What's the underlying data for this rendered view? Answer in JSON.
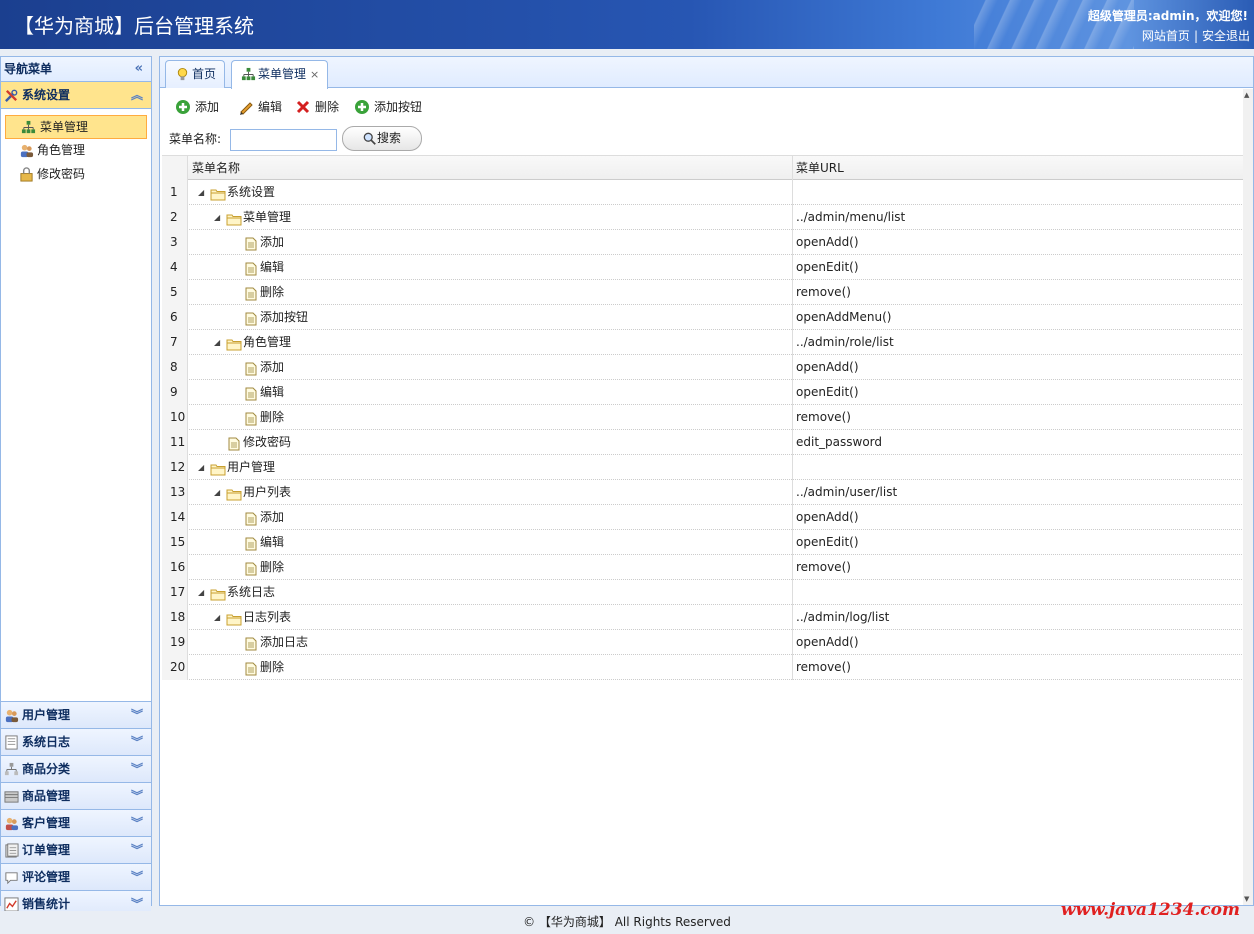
{
  "header": {
    "title": "【华为商城】后台管理系统",
    "user_text": "超级管理员:admin，欢迎您!",
    "link_home": "网站首页",
    "link_sep": "|",
    "link_logout": "安全退出"
  },
  "sidebar": {
    "title": "导航菜单",
    "active_section": {
      "label": "系统设置",
      "items": [
        "菜单管理",
        "角色管理",
        "修改密码"
      ]
    },
    "sections": [
      "用户管理",
      "系统日志",
      "商品分类",
      "商品管理",
      "客户管理",
      "订单管理",
      "评论管理",
      "销售统计"
    ]
  },
  "tabs": [
    {
      "label": "首页",
      "icon": "lightbulb-icon"
    },
    {
      "label": "菜单管理",
      "icon": "tree-icon",
      "close": "×"
    }
  ],
  "toolbar": {
    "add": "添加",
    "edit": "编辑",
    "delete": "删除",
    "add_button": "添加按钮"
  },
  "search": {
    "label": "菜单名称:",
    "value": "",
    "button": "搜索"
  },
  "grid": {
    "col_name": "菜单名称",
    "col_url": "菜单URL",
    "rows": [
      {
        "num": "1",
        "name": "系统设置",
        "url": "",
        "level": 0,
        "type": "folder"
      },
      {
        "num": "2",
        "name": "菜单管理",
        "url": "../admin/menu/list",
        "level": 1,
        "type": "folder"
      },
      {
        "num": "3",
        "name": "添加",
        "url": "openAdd()",
        "level": 2,
        "type": "file"
      },
      {
        "num": "4",
        "name": "编辑",
        "url": "openEdit()",
        "level": 2,
        "type": "file"
      },
      {
        "num": "5",
        "name": "删除",
        "url": "remove()",
        "level": 2,
        "type": "file"
      },
      {
        "num": "6",
        "name": "添加按钮",
        "url": "openAddMenu()",
        "level": 2,
        "type": "file"
      },
      {
        "num": "7",
        "name": "角色管理",
        "url": "../admin/role/list",
        "level": 1,
        "type": "folder"
      },
      {
        "num": "8",
        "name": "添加",
        "url": "openAdd()",
        "level": 2,
        "type": "file"
      },
      {
        "num": "9",
        "name": "编辑",
        "url": "openEdit()",
        "level": 2,
        "type": "file"
      },
      {
        "num": "10",
        "name": "删除",
        "url": "remove()",
        "level": 2,
        "type": "file"
      },
      {
        "num": "11",
        "name": "修改密码",
        "url": "edit_password",
        "level": 1,
        "type": "file"
      },
      {
        "num": "12",
        "name": "用户管理",
        "url": "",
        "level": 0,
        "type": "folder"
      },
      {
        "num": "13",
        "name": "用户列表",
        "url": "../admin/user/list",
        "level": 1,
        "type": "folder"
      },
      {
        "num": "14",
        "name": "添加",
        "url": "openAdd()",
        "level": 2,
        "type": "file"
      },
      {
        "num": "15",
        "name": "编辑",
        "url": "openEdit()",
        "level": 2,
        "type": "file"
      },
      {
        "num": "16",
        "name": "删除",
        "url": "remove()",
        "level": 2,
        "type": "file"
      },
      {
        "num": "17",
        "name": "系统日志",
        "url": "",
        "level": 0,
        "type": "folder"
      },
      {
        "num": "18",
        "name": "日志列表",
        "url": "../admin/log/list",
        "level": 1,
        "type": "folder"
      },
      {
        "num": "19",
        "name": "添加日志",
        "url": "openAdd()",
        "level": 2,
        "type": "file"
      },
      {
        "num": "20",
        "name": "删除",
        "url": "remove()",
        "level": 2,
        "type": "file"
      }
    ]
  },
  "footer": "©  【华为商城】  All Rights Reserved",
  "watermark": "www.java1234.com",
  "colors": {
    "header": "#2756b3",
    "selected": "#ffe48d",
    "border": "#95b8e7",
    "watermark": "#e02020"
  }
}
